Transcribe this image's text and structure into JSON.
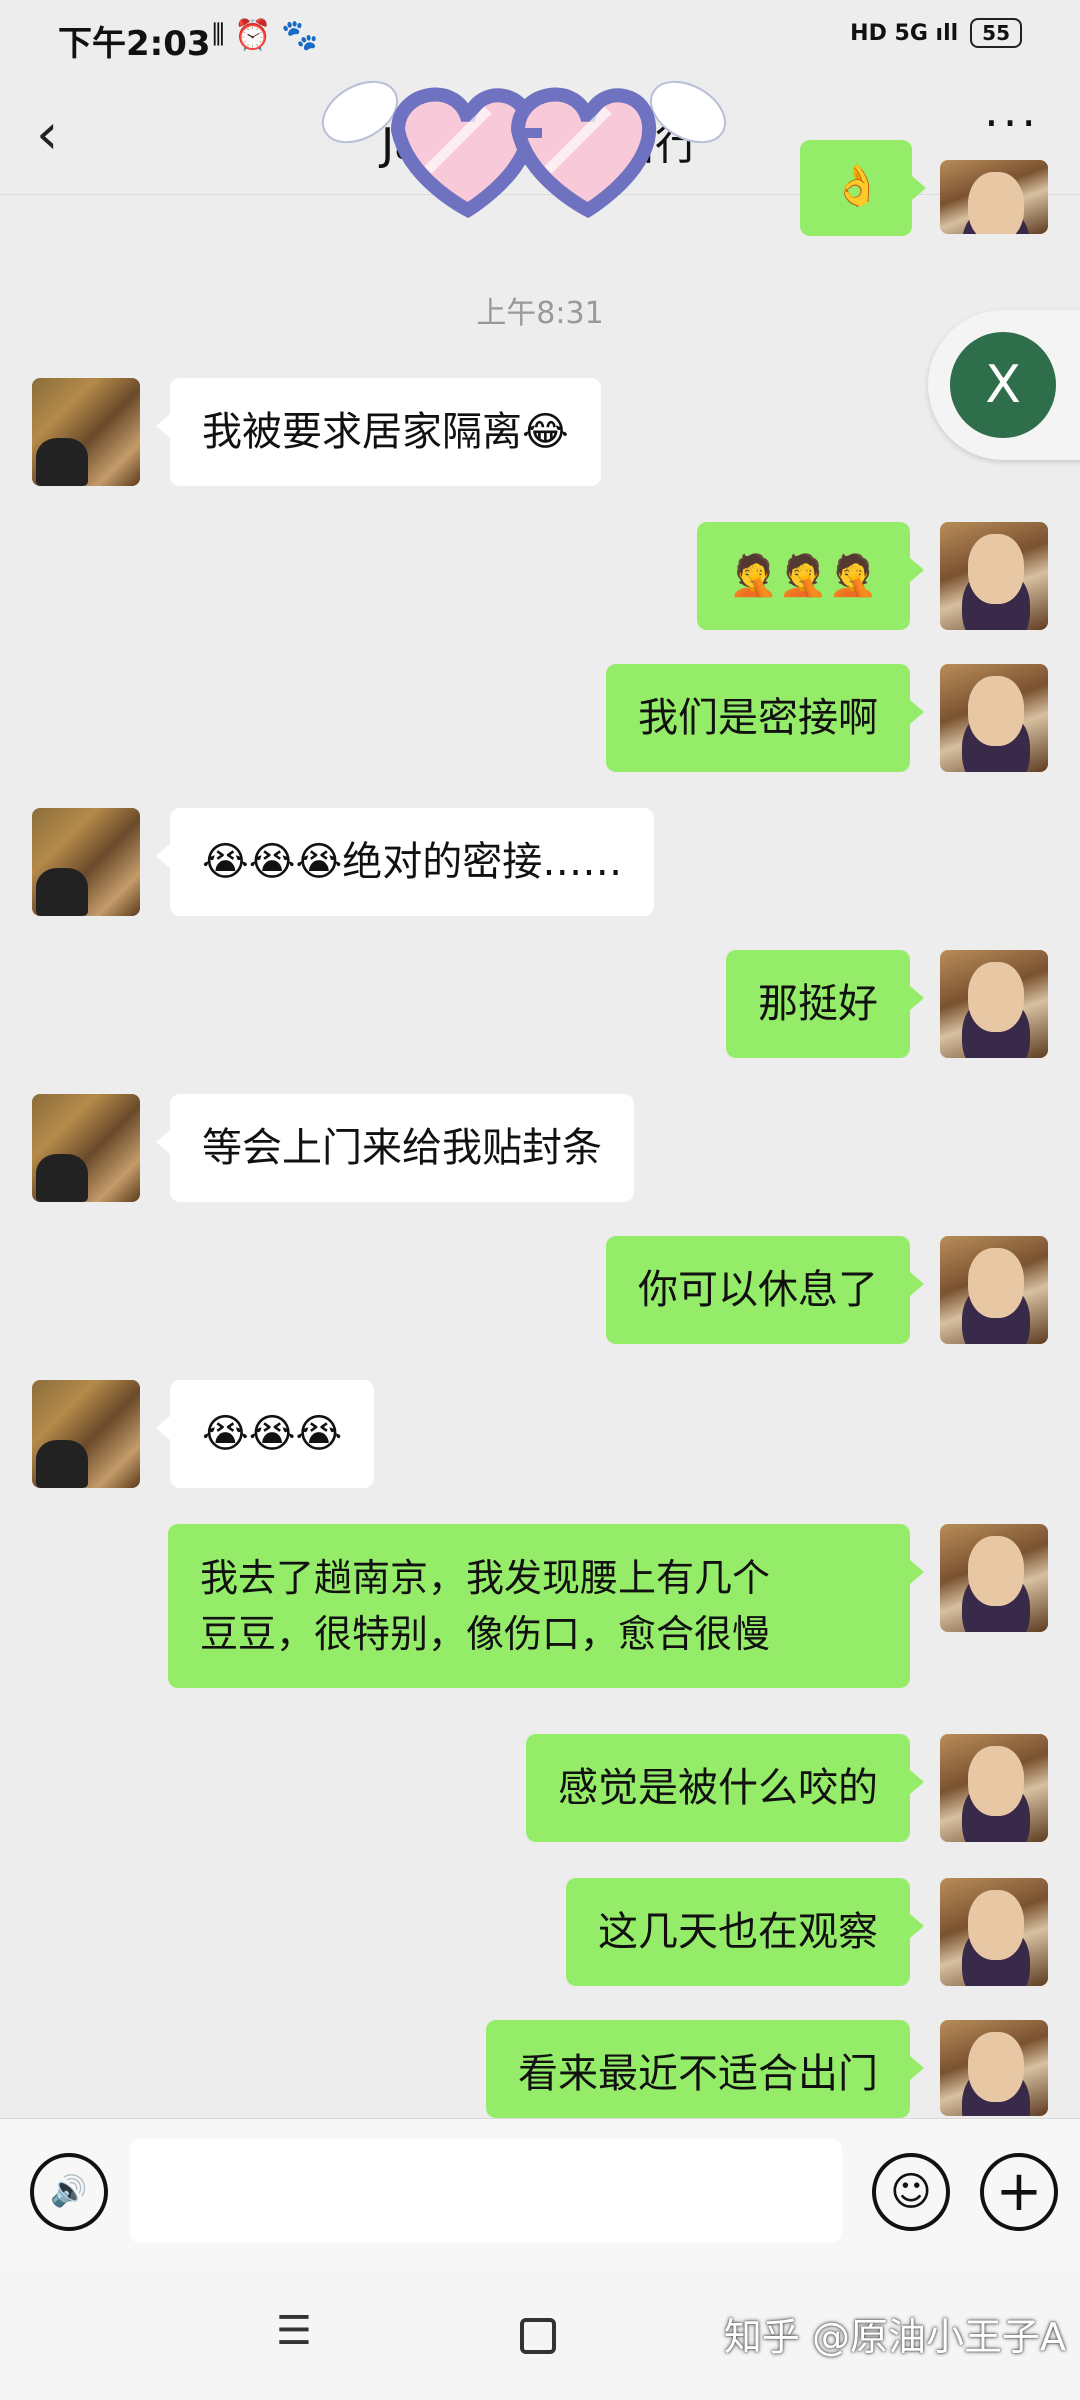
{
  "status_bar": {
    "time": "下午2:03",
    "icons": "⫴ ⏰ 🐾",
    "network": "HD 5G ıll",
    "battery": "55"
  },
  "header": {
    "back_icon": "‹",
    "title": "Jay D       婕    随出行",
    "more_icon": "···"
  },
  "timestamp": "上午8:31",
  "floating_button": {
    "label": "X"
  },
  "messages": [
    {
      "side": "right",
      "text": "👌"
    },
    {
      "side": "left",
      "text": "我被要求居家隔离😂"
    },
    {
      "side": "right",
      "text": "🤦🤦🤦"
    },
    {
      "side": "right",
      "text": "我们是密接啊"
    },
    {
      "side": "left",
      "text": "😭😭😭绝对的密接……"
    },
    {
      "side": "right",
      "text": "那挺好"
    },
    {
      "side": "left",
      "text": "等会上门来给我贴封条"
    },
    {
      "side": "right",
      "text": "你可以休息了"
    },
    {
      "side": "left",
      "text": "😭😭😭"
    },
    {
      "side": "right",
      "text": "我去了趟南京，我发现腰上有几个\n豆豆，很特别，像伤口，愈合很慢"
    },
    {
      "side": "right",
      "text": "感觉是被什么咬的"
    },
    {
      "side": "right",
      "text": "这几天也在观察"
    },
    {
      "side": "right",
      "text": "看来最近不适合出门"
    }
  ],
  "input_bar": {
    "voice_icon": "🔊",
    "emoji_icon": "☺",
    "add_icon": "+"
  },
  "system_nav": {
    "menu_icon": "☰",
    "watermark": "知乎 @原油小王子A"
  },
  "colors": {
    "background": "#ededed",
    "sent_bubble": "#95ec69",
    "received_bubble": "#ffffff",
    "floating_circle": "#2f6e4a"
  }
}
